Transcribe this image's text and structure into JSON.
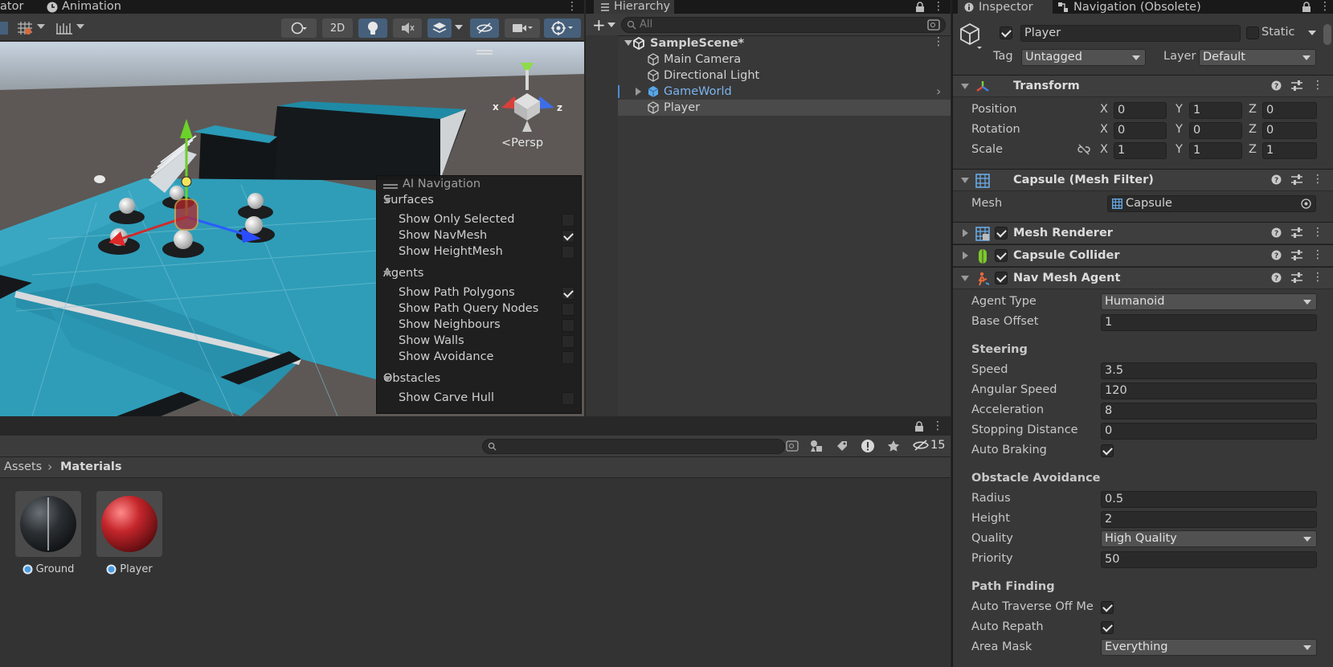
{
  "scene": {
    "tabs": [
      "ator",
      "Animation"
    ],
    "toolbar": {
      "mode_2d": "2D"
    },
    "persp_label": "Persp",
    "gizmo_x": "x",
    "gizmo_z": "z"
  },
  "ai_navigation": {
    "title": "AI Navigation",
    "sections": [
      {
        "label": "Surfaces",
        "items": [
          {
            "label": "Show Only Selected",
            "checked": false
          },
          {
            "label": "Show NavMesh",
            "checked": true
          },
          {
            "label": "Show HeightMesh",
            "checked": false
          }
        ]
      },
      {
        "label": "Agents",
        "items": [
          {
            "label": "Show Path Polygons",
            "checked": true
          },
          {
            "label": "Show Path Query Nodes",
            "checked": false
          },
          {
            "label": "Show Neighbours",
            "checked": false
          },
          {
            "label": "Show Walls",
            "checked": false
          },
          {
            "label": "Show Avoidance",
            "checked": false
          }
        ]
      },
      {
        "label": "Obstacles",
        "items": [
          {
            "label": "Show Carve Hull",
            "checked": false
          }
        ]
      }
    ]
  },
  "hierarchy": {
    "tab": "Hierarchy",
    "search_placeholder": "All",
    "scene_name": "SampleScene*",
    "items": [
      "Main Camera",
      "Directional Light",
      "GameWorld",
      "Player"
    ]
  },
  "project": {
    "breadcrumb": [
      "Assets",
      "Materials"
    ],
    "hidden_count": "15",
    "assets": [
      {
        "name": "Ground",
        "color": "#2b2f33"
      },
      {
        "name": "Player",
        "color": "#c4262b"
      }
    ]
  },
  "inspector": {
    "tabs": [
      "Inspector",
      "Navigation (Obsolete)"
    ],
    "object_name": "Player",
    "static_label": "Static",
    "tag_label": "Tag",
    "tag_value": "Untagged",
    "layer_label": "Layer",
    "layer_value": "Default",
    "transform": {
      "title": "Transform",
      "position_label": "Position",
      "position": [
        "0",
        "1",
        "0"
      ],
      "rotation_label": "Rotation",
      "rotation": [
        "0",
        "0",
        "0"
      ],
      "scale_label": "Scale",
      "scale": [
        "1",
        "1",
        "1"
      ],
      "axes": [
        "X",
        "Y",
        "Z"
      ]
    },
    "mesh_filter": {
      "title": "Capsule (Mesh Filter)",
      "mesh_label": "Mesh",
      "mesh_value": "Capsule"
    },
    "mesh_renderer": {
      "title": "Mesh Renderer"
    },
    "capsule_collider": {
      "title": "Capsule Collider"
    },
    "nav_mesh_agent": {
      "title": "Nav Mesh Agent",
      "agent_type_label": "Agent Type",
      "agent_type": "Humanoid",
      "base_offset_label": "Base Offset",
      "base_offset": "1",
      "steering": "Steering",
      "speed_label": "Speed",
      "speed": "3.5",
      "angular_speed_label": "Angular Speed",
      "angular_speed": "120",
      "acceleration_label": "Acceleration",
      "acceleration": "8",
      "stopping_distance_label": "Stopping Distance",
      "stopping_distance": "0",
      "auto_braking_label": "Auto Braking",
      "obstacle_avoidance": "Obstacle Avoidance",
      "radius_label": "Radius",
      "radius": "0.5",
      "height_label": "Height",
      "height": "2",
      "quality_label": "Quality",
      "quality": "High Quality",
      "priority_label": "Priority",
      "priority": "50",
      "path_finding": "Path Finding",
      "auto_traverse_label": "Auto Traverse Off Me",
      "auto_repath_label": "Auto Repath",
      "area_mask_label": "Area Mask",
      "area_mask": "Everything"
    }
  }
}
